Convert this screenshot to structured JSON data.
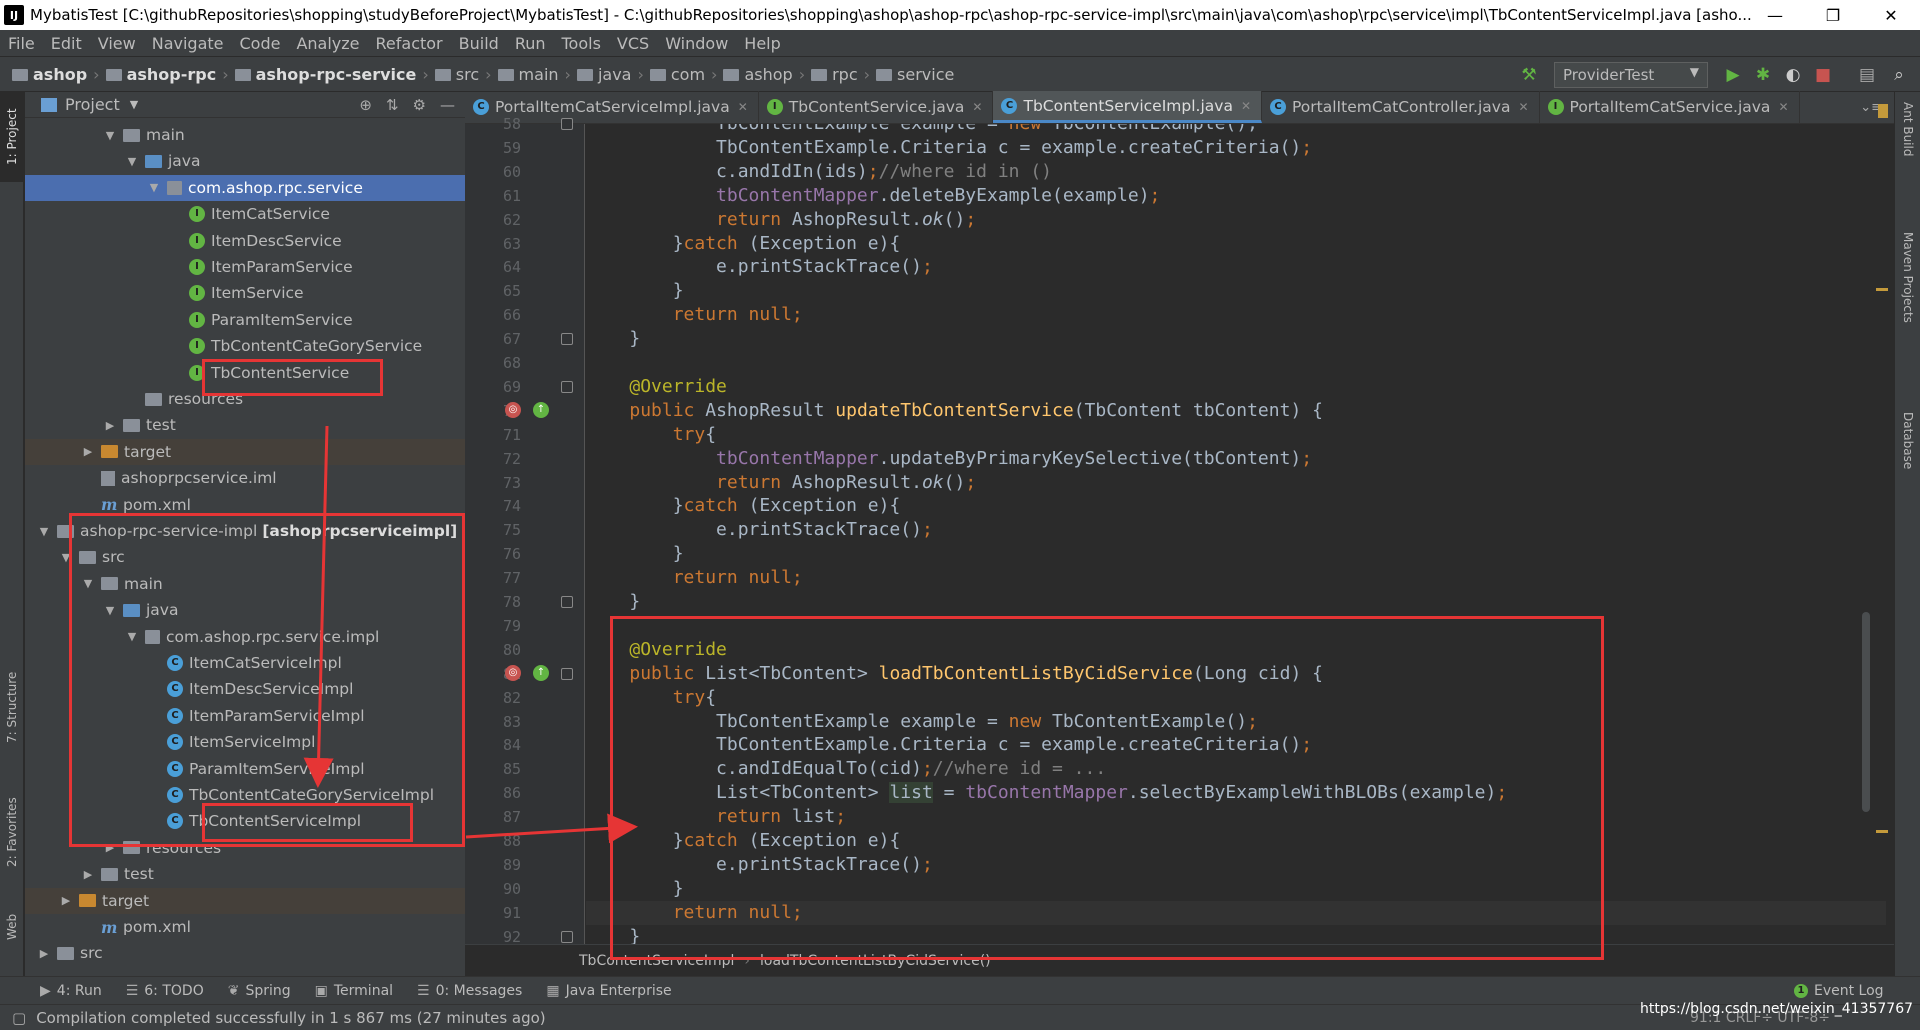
{
  "window": {
    "title": "MybatisTest [C:\\githubRepositories\\shopping\\studyBeforeProject\\MybatisTest] - C:\\githubRepositories\\shopping\\ashop\\ashop-rpc\\ashop-rpc-service-impl\\src\\main\\java\\com\\ashop\\rpc\\service\\impl\\TbContentServiceImpl.java [asho...",
    "app_icon": "IJ",
    "minimize": "—",
    "restore": "❐",
    "close": "✕"
  },
  "menu": [
    "File",
    "Edit",
    "View",
    "Navigate",
    "Code",
    "Analyze",
    "Refactor",
    "Build",
    "Run",
    "Tools",
    "VCS",
    "Window",
    "Help"
  ],
  "breadcrumbs": [
    "ashop",
    "ashop-rpc",
    "ashop-rpc-service",
    "src",
    "main",
    "java",
    "com",
    "ashop",
    "rpc",
    "service"
  ],
  "run_config": "ProviderTest",
  "left_tabs": {
    "project": "1: Project",
    "structure": "7: Structure",
    "favorites": "2: Favorites",
    "web": "Web"
  },
  "right_tabs": {
    "ant": "Ant Build",
    "maven": "Maven Projects",
    "database": "Database"
  },
  "project_panel": {
    "title": "Project",
    "tree": [
      {
        "label": "main",
        "kind": "folder",
        "depth": 4,
        "open": true
      },
      {
        "label": "java",
        "kind": "src",
        "depth": 5,
        "open": true
      },
      {
        "label": "com.ashop.rpc.service",
        "kind": "pkg",
        "depth": 6,
        "open": true,
        "selected": true
      },
      {
        "label": "ItemCatService",
        "kind": "interface",
        "depth": 7
      },
      {
        "label": "ItemDescService",
        "kind": "interface",
        "depth": 7
      },
      {
        "label": "ItemParamService",
        "kind": "interface",
        "depth": 7
      },
      {
        "label": "ItemService",
        "kind": "interface",
        "depth": 7
      },
      {
        "label": "ParamItemService",
        "kind": "interface",
        "depth": 7
      },
      {
        "label": "TbContentCateGoryService",
        "kind": "interface",
        "depth": 7
      },
      {
        "label": "TbContentService",
        "kind": "interface",
        "depth": 7
      },
      {
        "label": "resources",
        "kind": "res",
        "depth": 5
      },
      {
        "label": "test",
        "kind": "folder",
        "depth": 4,
        "closed": true
      },
      {
        "label": "target",
        "kind": "target",
        "depth": 3,
        "closed": true
      },
      {
        "label": "ashoprpcservice.iml",
        "kind": "iml",
        "depth": 3
      },
      {
        "label": "pom.xml",
        "kind": "pom",
        "depth": 3
      },
      {
        "label": "ashop-rpc-service-impl",
        "bold": "[ashoprpcserviceimpl]",
        "kind": "module",
        "depth": 1,
        "open": true
      },
      {
        "label": "src",
        "kind": "folder",
        "depth": 2,
        "open": true
      },
      {
        "label": "main",
        "kind": "folder",
        "depth": 3,
        "open": true
      },
      {
        "label": "java",
        "kind": "src",
        "depth": 4,
        "open": true
      },
      {
        "label": "com.ashop.rpc.service.impl",
        "kind": "pkg",
        "depth": 5,
        "open": true
      },
      {
        "label": "ItemCatServiceImpl",
        "kind": "class",
        "depth": 6
      },
      {
        "label": "ItemDescServiceImpl",
        "kind": "class",
        "depth": 6
      },
      {
        "label": "ItemParamServiceImpl",
        "kind": "class",
        "depth": 6
      },
      {
        "label": "ItemServiceImpl",
        "kind": "class",
        "depth": 6
      },
      {
        "label": "ParamItemServiceImpl",
        "kind": "class",
        "depth": 6
      },
      {
        "label": "TbContentCateGoryServiceImpl",
        "kind": "class",
        "depth": 6
      },
      {
        "label": "TbContentServiceImpl",
        "kind": "class",
        "depth": 6
      },
      {
        "label": "resources",
        "kind": "res",
        "depth": 4,
        "closed": true
      },
      {
        "label": "test",
        "kind": "folder",
        "depth": 3,
        "closed": true
      },
      {
        "label": "target",
        "kind": "target",
        "depth": 2,
        "closed": true
      },
      {
        "label": "pom.xml",
        "kind": "pom",
        "depth": 3
      },
      {
        "label": "src",
        "kind": "folder",
        "depth": 1,
        "closed": true
      }
    ]
  },
  "editor_tabs": [
    {
      "label": "PortalItemCatServiceImpl.java",
      "icon": "C",
      "active": false
    },
    {
      "label": "TbContentService.java",
      "icon": "I",
      "active": false
    },
    {
      "label": "TbContentServiceImpl.java",
      "icon": "C",
      "active": true
    },
    {
      "label": "PortalItemCatController.java",
      "icon": "C",
      "active": false
    },
    {
      "label": "PortalItemCatService.java",
      "icon": "I",
      "active": false
    }
  ],
  "code_lines": [
    {
      "n": "58",
      "html": "            <span>TbContentExample example = </span><span class=\"k\">new</span><span> TbContentExample();</span>"
    },
    {
      "n": "59",
      "html": "            TbContentExample.Criteria c = example.createCriteria()<span class=\"k\">;</span>"
    },
    {
      "n": "60",
      "html": "            c.andIdIn(ids)<span class=\"k\">;</span><span class=\"cm\">//where id in ()</span>"
    },
    {
      "n": "61",
      "html": "            <span class=\"fi\">tbContentMapper</span>.deleteByExample(example)<span class=\"k\">;</span>"
    },
    {
      "n": "62",
      "html": "            <span class=\"k\">return</span> AshopResult.<span class=\"it\">ok</span>()<span class=\"k\">;</span>"
    },
    {
      "n": "63",
      "html": "        }<span class=\"k\">catch</span> (Exception e){"
    },
    {
      "n": "64",
      "html": "            e.printStackTrace()<span class=\"k\">;</span>"
    },
    {
      "n": "65",
      "html": "        }"
    },
    {
      "n": "66",
      "html": "        <span class=\"k\">return null;</span>"
    },
    {
      "n": "67",
      "html": "    }"
    },
    {
      "n": "68",
      "html": ""
    },
    {
      "n": "69",
      "html": "    <span class=\"a\">@Override</span>"
    },
    {
      "n": "70",
      "html": "    <span class=\"k\">public</span> AshopResult <span class=\"f\">updateTbContentService</span>(TbContent tbContent) {"
    },
    {
      "n": "71",
      "html": "        <span class=\"k\">try</span>{"
    },
    {
      "n": "72",
      "html": "            <span class=\"fi\">tbContentMapper</span>.updateByPrimaryKeySelective(tbContent)<span class=\"k\">;</span>"
    },
    {
      "n": "73",
      "html": "            <span class=\"k\">return</span> AshopResult.<span class=\"it\">ok</span>()<span class=\"k\">;</span>"
    },
    {
      "n": "74",
      "html": "        }<span class=\"k\">catch</span> (Exception e){"
    },
    {
      "n": "75",
      "html": "            e.printStackTrace()<span class=\"k\">;</span>"
    },
    {
      "n": "76",
      "html": "        }"
    },
    {
      "n": "77",
      "html": "        <span class=\"k\">return null;</span>"
    },
    {
      "n": "78",
      "html": "    }"
    },
    {
      "n": "79",
      "html": ""
    },
    {
      "n": "80",
      "html": "    <span class=\"a\">@Override</span>"
    },
    {
      "n": "81",
      "html": "    <span class=\"k\">public</span> List&lt;TbContent&gt; <span class=\"f\">loadTbContentListByCidService</span>(Long cid) {"
    },
    {
      "n": "82",
      "html": "        <span class=\"k\">try</span>{"
    },
    {
      "n": "83",
      "html": "            TbContentExample example = <span class=\"k\">new</span> TbContentExample()<span class=\"k\">;</span>"
    },
    {
      "n": "84",
      "html": "            TbContentExample.Criteria c = example.createCriteria()<span class=\"k\">;</span>"
    },
    {
      "n": "85",
      "html": "            c.andIdEqualTo(cid)<span class=\"k\">;</span><span class=\"cm\">//where id = ...</span>"
    },
    {
      "n": "86",
      "html": "            List&lt;TbContent&gt; <span class=\"hl\">list</span> = <span class=\"fi\">tbContentMapper</span>.selectByExampleWithBLOBs(example)<span class=\"k\">;</span>"
    },
    {
      "n": "87",
      "html": "            <span class=\"k\">return</span> list<span class=\"k\">;</span>"
    },
    {
      "n": "88",
      "html": "        }<span class=\"k\">catch</span> (Exception e){"
    },
    {
      "n": "89",
      "html": "            e.printStackTrace()<span class=\"k\">;</span>"
    },
    {
      "n": "90",
      "html": "        }"
    },
    {
      "n": "91",
      "html": "        <span class=\"k\">return null;</span>"
    },
    {
      "n": "92",
      "html": "    }"
    }
  ],
  "editor_breadcrumb": {
    "class": "TbContentServiceImpl",
    "method": "loadTbContentListByCidService()"
  },
  "bottom_tools": [
    {
      "label": "4: Run",
      "icon": "▶"
    },
    {
      "label": "6: TODO",
      "icon": "☰"
    },
    {
      "label": "Spring",
      "icon": "❦"
    },
    {
      "label": "Terminal",
      "icon": "▣"
    },
    {
      "label": "0: Messages",
      "icon": "☰"
    },
    {
      "label": "Java Enterprise",
      "icon": "▦"
    }
  ],
  "event_log": "Event Log",
  "status": "Compilation completed successfully in 1 s 867 ms (27 minutes ago)",
  "status_right": "91:1  CRLF÷  UTF-8÷",
  "watermark": "https://blog.csdn.net/weixin_41357767",
  "colors": {
    "annotation_red": "#e63535",
    "selection": "#4b6eaf",
    "keyword": "#cc7832",
    "method": "#ffc66d",
    "field": "#9876aa"
  }
}
